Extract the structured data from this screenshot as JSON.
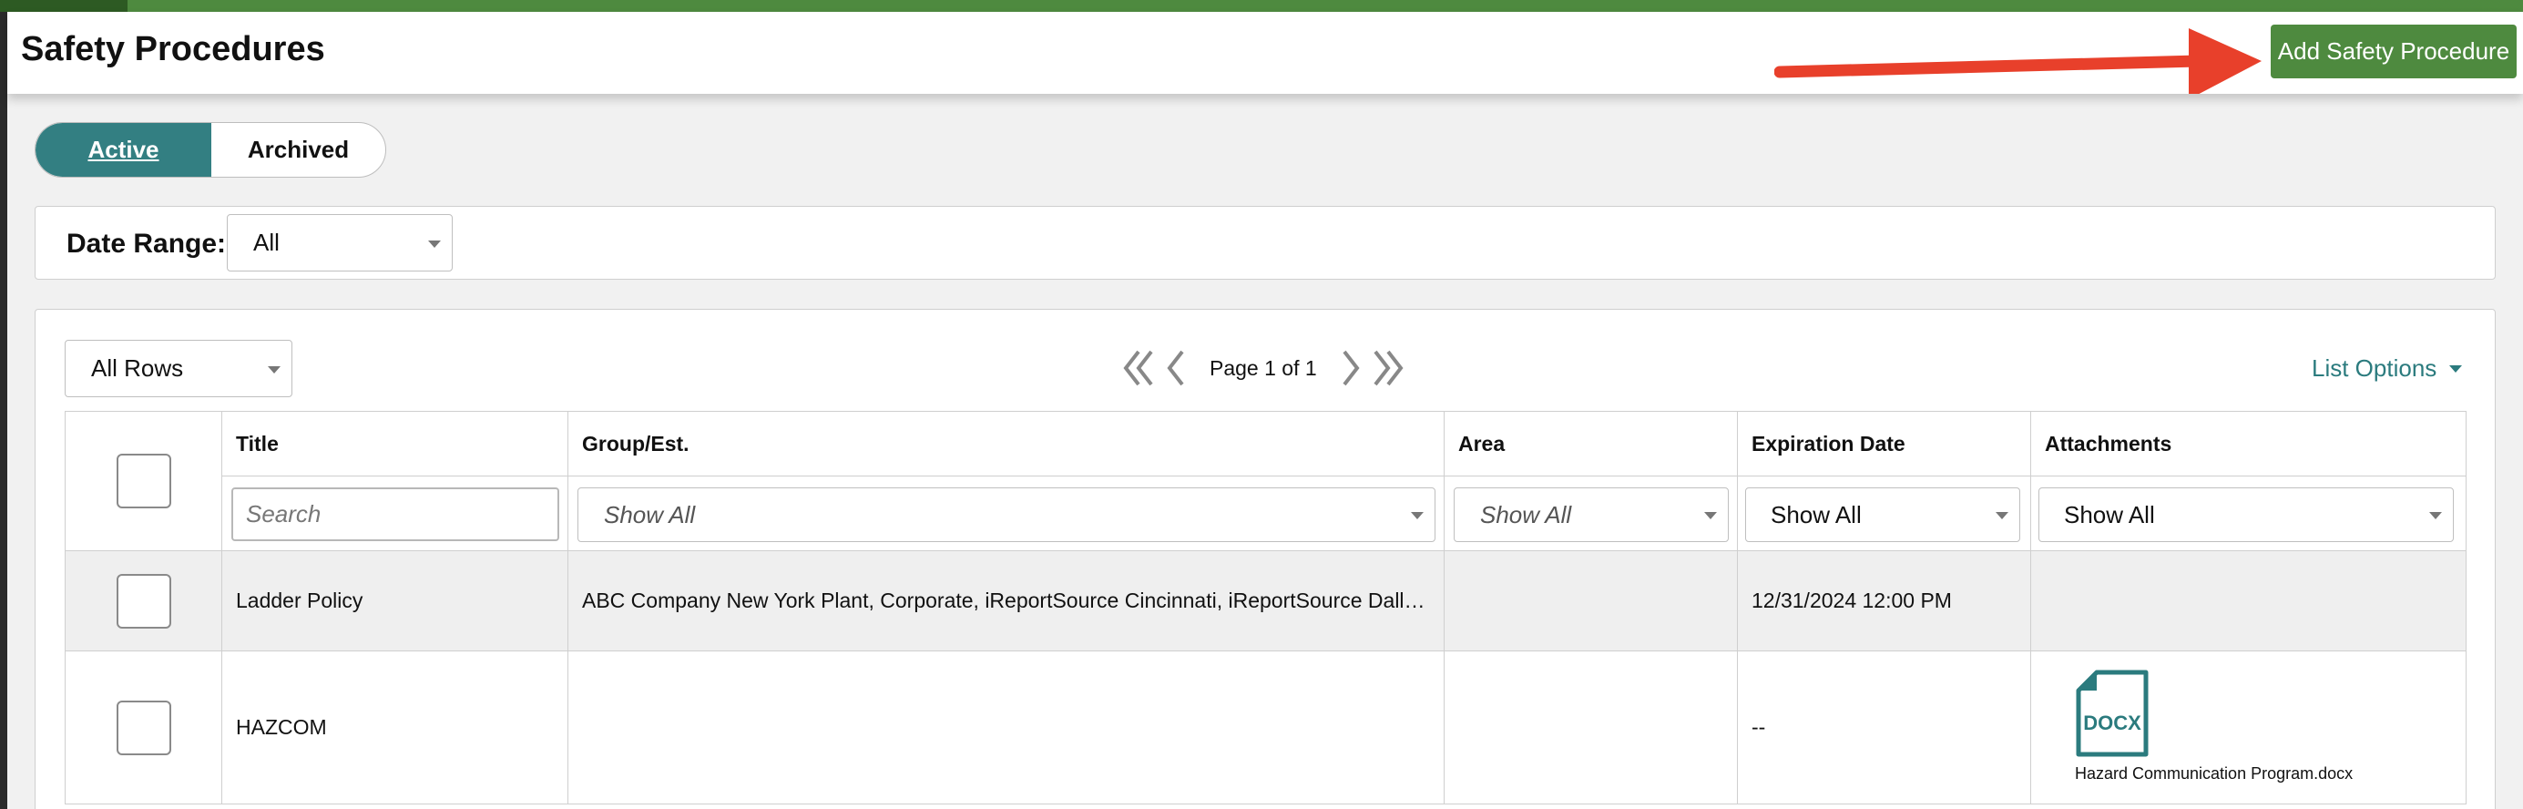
{
  "header": {
    "title": "Safety Procedures",
    "add_button": "Add Safety Procedure"
  },
  "colors": {
    "brand_green": "#4e8a3f",
    "teal": "#337f82",
    "arrow_red": "#e8402b"
  },
  "tabs": {
    "active": "Active",
    "archived": "Archived"
  },
  "filters": {
    "date_range_label": "Date Range:",
    "date_range_value": "All"
  },
  "list": {
    "rows_select": "All Rows",
    "page_text": "Page 1 of 1",
    "list_options": "List Options"
  },
  "table": {
    "columns": {
      "title": "Title",
      "group": "Group/Est.",
      "area": "Area",
      "expiration": "Expiration Date",
      "attachments": "Attachments"
    },
    "filters": {
      "title_placeholder": "Search",
      "group": "Show All",
      "area": "Show All",
      "expiration": "Show All",
      "attachments": "Show All"
    },
    "rows": [
      {
        "title": "Ladder Policy",
        "group": "ABC Company New York Plant, Corporate, iReportSource Cincinnati, iReportSource Dallas…",
        "area": "",
        "expiration": "12/31/2024 12:00 PM",
        "attachment": ""
      },
      {
        "title": "HAZCOM",
        "group": "",
        "area": "",
        "expiration": "--",
        "attachment_type": "DOCX",
        "attachment": "Hazard Communication Program.docx"
      }
    ]
  }
}
